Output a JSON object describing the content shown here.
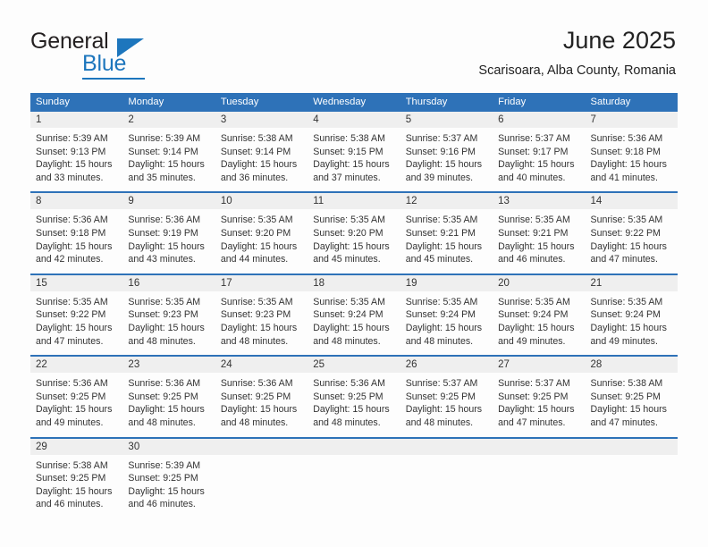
{
  "brand": {
    "name_top": "General",
    "name_bottom": "Blue",
    "accent_color": "#1d76bd"
  },
  "header": {
    "title": "June 2025",
    "subtitle": "Scarisoara, Alba County, Romania"
  },
  "theme": {
    "header_bar_color": "#2e72b8",
    "date_band_color": "#efefef",
    "text_color": "#333333",
    "page_background": "#fdfdfd"
  },
  "calendar": {
    "weekday_headers": [
      "Sunday",
      "Monday",
      "Tuesday",
      "Wednesday",
      "Thursday",
      "Friday",
      "Saturday"
    ],
    "weeks": [
      {
        "dates": [
          "1",
          "2",
          "3",
          "4",
          "5",
          "6",
          "7"
        ],
        "cells": [
          {
            "sunrise": "Sunrise: 5:39 AM",
            "sunset": "Sunset: 9:13 PM",
            "daylight_1": "Daylight: 15 hours",
            "daylight_2": "and 33 minutes."
          },
          {
            "sunrise": "Sunrise: 5:39 AM",
            "sunset": "Sunset: 9:14 PM",
            "daylight_1": "Daylight: 15 hours",
            "daylight_2": "and 35 minutes."
          },
          {
            "sunrise": "Sunrise: 5:38 AM",
            "sunset": "Sunset: 9:14 PM",
            "daylight_1": "Daylight: 15 hours",
            "daylight_2": "and 36 minutes."
          },
          {
            "sunrise": "Sunrise: 5:38 AM",
            "sunset": "Sunset: 9:15 PM",
            "daylight_1": "Daylight: 15 hours",
            "daylight_2": "and 37 minutes."
          },
          {
            "sunrise": "Sunrise: 5:37 AM",
            "sunset": "Sunset: 9:16 PM",
            "daylight_1": "Daylight: 15 hours",
            "daylight_2": "and 39 minutes."
          },
          {
            "sunrise": "Sunrise: 5:37 AM",
            "sunset": "Sunset: 9:17 PM",
            "daylight_1": "Daylight: 15 hours",
            "daylight_2": "and 40 minutes."
          },
          {
            "sunrise": "Sunrise: 5:36 AM",
            "sunset": "Sunset: 9:18 PM",
            "daylight_1": "Daylight: 15 hours",
            "daylight_2": "and 41 minutes."
          }
        ]
      },
      {
        "dates": [
          "8",
          "9",
          "10",
          "11",
          "12",
          "13",
          "14"
        ],
        "cells": [
          {
            "sunrise": "Sunrise: 5:36 AM",
            "sunset": "Sunset: 9:18 PM",
            "daylight_1": "Daylight: 15 hours",
            "daylight_2": "and 42 minutes."
          },
          {
            "sunrise": "Sunrise: 5:36 AM",
            "sunset": "Sunset: 9:19 PM",
            "daylight_1": "Daylight: 15 hours",
            "daylight_2": "and 43 minutes."
          },
          {
            "sunrise": "Sunrise: 5:35 AM",
            "sunset": "Sunset: 9:20 PM",
            "daylight_1": "Daylight: 15 hours",
            "daylight_2": "and 44 minutes."
          },
          {
            "sunrise": "Sunrise: 5:35 AM",
            "sunset": "Sunset: 9:20 PM",
            "daylight_1": "Daylight: 15 hours",
            "daylight_2": "and 45 minutes."
          },
          {
            "sunrise": "Sunrise: 5:35 AM",
            "sunset": "Sunset: 9:21 PM",
            "daylight_1": "Daylight: 15 hours",
            "daylight_2": "and 45 minutes."
          },
          {
            "sunrise": "Sunrise: 5:35 AM",
            "sunset": "Sunset: 9:21 PM",
            "daylight_1": "Daylight: 15 hours",
            "daylight_2": "and 46 minutes."
          },
          {
            "sunrise": "Sunrise: 5:35 AM",
            "sunset": "Sunset: 9:22 PM",
            "daylight_1": "Daylight: 15 hours",
            "daylight_2": "and 47 minutes."
          }
        ]
      },
      {
        "dates": [
          "15",
          "16",
          "17",
          "18",
          "19",
          "20",
          "21"
        ],
        "cells": [
          {
            "sunrise": "Sunrise: 5:35 AM",
            "sunset": "Sunset: 9:22 PM",
            "daylight_1": "Daylight: 15 hours",
            "daylight_2": "and 47 minutes."
          },
          {
            "sunrise": "Sunrise: 5:35 AM",
            "sunset": "Sunset: 9:23 PM",
            "daylight_1": "Daylight: 15 hours",
            "daylight_2": "and 48 minutes."
          },
          {
            "sunrise": "Sunrise: 5:35 AM",
            "sunset": "Sunset: 9:23 PM",
            "daylight_1": "Daylight: 15 hours",
            "daylight_2": "and 48 minutes."
          },
          {
            "sunrise": "Sunrise: 5:35 AM",
            "sunset": "Sunset: 9:24 PM",
            "daylight_1": "Daylight: 15 hours",
            "daylight_2": "and 48 minutes."
          },
          {
            "sunrise": "Sunrise: 5:35 AM",
            "sunset": "Sunset: 9:24 PM",
            "daylight_1": "Daylight: 15 hours",
            "daylight_2": "and 48 minutes."
          },
          {
            "sunrise": "Sunrise: 5:35 AM",
            "sunset": "Sunset: 9:24 PM",
            "daylight_1": "Daylight: 15 hours",
            "daylight_2": "and 49 minutes."
          },
          {
            "sunrise": "Sunrise: 5:35 AM",
            "sunset": "Sunset: 9:24 PM",
            "daylight_1": "Daylight: 15 hours",
            "daylight_2": "and 49 minutes."
          }
        ]
      },
      {
        "dates": [
          "22",
          "23",
          "24",
          "25",
          "26",
          "27",
          "28"
        ],
        "cells": [
          {
            "sunrise": "Sunrise: 5:36 AM",
            "sunset": "Sunset: 9:25 PM",
            "daylight_1": "Daylight: 15 hours",
            "daylight_2": "and 49 minutes."
          },
          {
            "sunrise": "Sunrise: 5:36 AM",
            "sunset": "Sunset: 9:25 PM",
            "daylight_1": "Daylight: 15 hours",
            "daylight_2": "and 48 minutes."
          },
          {
            "sunrise": "Sunrise: 5:36 AM",
            "sunset": "Sunset: 9:25 PM",
            "daylight_1": "Daylight: 15 hours",
            "daylight_2": "and 48 minutes."
          },
          {
            "sunrise": "Sunrise: 5:36 AM",
            "sunset": "Sunset: 9:25 PM",
            "daylight_1": "Daylight: 15 hours",
            "daylight_2": "and 48 minutes."
          },
          {
            "sunrise": "Sunrise: 5:37 AM",
            "sunset": "Sunset: 9:25 PM",
            "daylight_1": "Daylight: 15 hours",
            "daylight_2": "and 48 minutes."
          },
          {
            "sunrise": "Sunrise: 5:37 AM",
            "sunset": "Sunset: 9:25 PM",
            "daylight_1": "Daylight: 15 hours",
            "daylight_2": "and 47 minutes."
          },
          {
            "sunrise": "Sunrise: 5:38 AM",
            "sunset": "Sunset: 9:25 PM",
            "daylight_1": "Daylight: 15 hours",
            "daylight_2": "and 47 minutes."
          }
        ]
      },
      {
        "dates": [
          "29",
          "30",
          "",
          "",
          "",
          "",
          ""
        ],
        "cells": [
          {
            "sunrise": "Sunrise: 5:38 AM",
            "sunset": "Sunset: 9:25 PM",
            "daylight_1": "Daylight: 15 hours",
            "daylight_2": "and 46 minutes."
          },
          {
            "sunrise": "Sunrise: 5:39 AM",
            "sunset": "Sunset: 9:25 PM",
            "daylight_1": "Daylight: 15 hours",
            "daylight_2": "and 46 minutes."
          },
          {
            "sunrise": "",
            "sunset": "",
            "daylight_1": "",
            "daylight_2": ""
          },
          {
            "sunrise": "",
            "sunset": "",
            "daylight_1": "",
            "daylight_2": ""
          },
          {
            "sunrise": "",
            "sunset": "",
            "daylight_1": "",
            "daylight_2": ""
          },
          {
            "sunrise": "",
            "sunset": "",
            "daylight_1": "",
            "daylight_2": ""
          },
          {
            "sunrise": "",
            "sunset": "",
            "daylight_1": "",
            "daylight_2": ""
          }
        ]
      }
    ]
  }
}
